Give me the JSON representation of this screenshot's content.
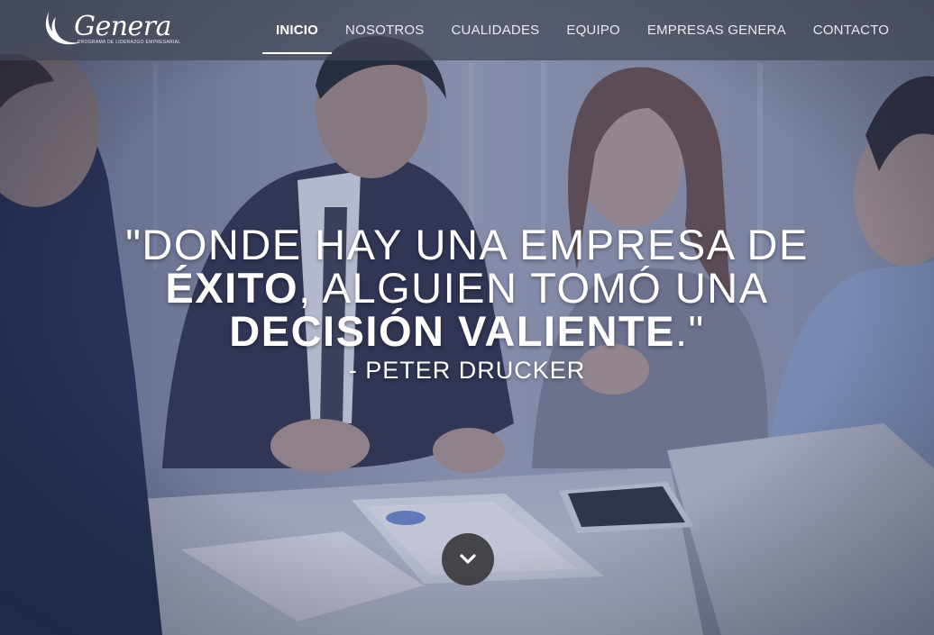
{
  "brand": {
    "name": "Genera",
    "tagline": "PROGRAMA DE LIDERAZGO EMPRESARIAL"
  },
  "nav": {
    "items": [
      {
        "label": "INICIO",
        "active": true
      },
      {
        "label": "NOSOTROS",
        "active": false
      },
      {
        "label": "CUALIDADES",
        "active": false
      },
      {
        "label": "EQUIPO",
        "active": false
      },
      {
        "label": "EMPRESAS GENERA",
        "active": false
      },
      {
        "label": "CONTACTO",
        "active": false
      }
    ]
  },
  "hero": {
    "quote": {
      "line1": "\"DONDE HAY UNA EMPRESA DE",
      "line2_bold": "ÉXITO",
      "line2_rest": ", ALGUIEN TOMÓ UNA",
      "line3_bold": "DECISIÓN VALIENTE",
      "line3_rest": ".\"",
      "author": "- PETER DRUCKER"
    },
    "scroll_icon": "chevron-down-icon"
  },
  "colors": {
    "overlay": "#5b6177",
    "topbar": "#424656",
    "scroll_button": "#3a3a3e",
    "text": "#ffffff"
  }
}
